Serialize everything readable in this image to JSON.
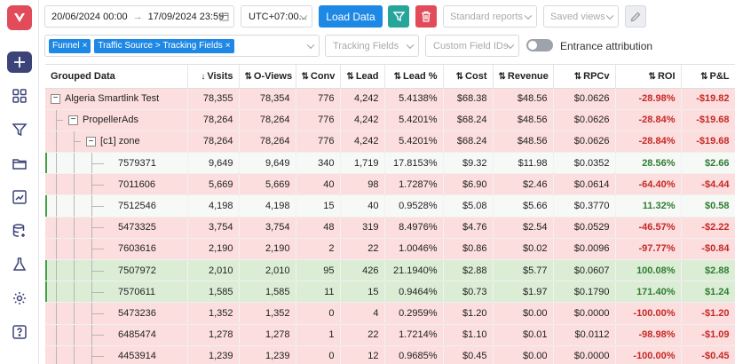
{
  "sidebar": {
    "items": [
      "plus-icon",
      "dashboard-icon",
      "funnel-icon",
      "folder-icon",
      "chart-icon",
      "database-icon",
      "flask-icon",
      "gear-icon",
      "help-icon"
    ]
  },
  "toolbar": {
    "date_from": "20/06/2024 00:00",
    "date_sep": "→",
    "date_to": "17/09/2024 23:59",
    "timezone": "UTC+07:00...",
    "load_label": "Load Data",
    "standard_reports": "Standard reports",
    "saved_views": "Saved views"
  },
  "filters": {
    "tags": [
      "Funnel",
      "Traffic Source > Tracking Fields"
    ],
    "tracking_fields": "Tracking Fields",
    "custom_field_ids": "Custom Field IDs",
    "entrance_attribution": "Entrance attribution"
  },
  "colors": {
    "accent": "#1e88e5",
    "filter_btn": "#26a69a",
    "delete_btn": "#e14b5a",
    "neg_row": "#fbdedd",
    "pos_row": "#dcedd6"
  },
  "table": {
    "columns": [
      "Grouped Data",
      "Visits",
      "O-Views",
      "Conv",
      "Lead",
      "Lead %",
      "Cost",
      "Revenue",
      "RPCv",
      "ROI",
      "P&L"
    ],
    "sort_arrows": [
      "",
      "↓",
      "⇅",
      "⇅",
      "⇅",
      "⇅",
      "⇅",
      "⇅",
      "⇅",
      "⇅",
      "⇅"
    ],
    "rows": [
      {
        "level": 0,
        "toggle": "−",
        "name": "Algeria Smartlink Test",
        "tone": "neg",
        "cells": [
          "78,355",
          "78,354",
          "776",
          "4,242",
          "5.4138%",
          "$68.38",
          "$48.56",
          "$0.0626",
          "-28.98%",
          "-$19.82"
        ]
      },
      {
        "level": 1,
        "toggle": "−",
        "name": "PropellerAds",
        "tone": "neg",
        "cells": [
          "78,264",
          "78,264",
          "776",
          "4,242",
          "5.4201%",
          "$68.24",
          "$48.56",
          "$0.0626",
          "-28.84%",
          "-$19.68"
        ]
      },
      {
        "level": 2,
        "toggle": "−",
        "name": "[c1] zone",
        "tone": "neg",
        "cells": [
          "78,264",
          "78,264",
          "776",
          "4,242",
          "5.4201%",
          "$68.24",
          "$48.56",
          "$0.0626",
          "-28.84%",
          "-$19.68"
        ]
      },
      {
        "level": 3,
        "toggle": "",
        "name": "7579371",
        "tone": "neu",
        "cells": [
          "9,649",
          "9,649",
          "340",
          "1,719",
          "17.8153%",
          "$9.32",
          "$11.98",
          "$0.0352",
          "28.56%",
          "$2.66"
        ]
      },
      {
        "level": 3,
        "toggle": "",
        "name": "7011606",
        "tone": "neg",
        "cells": [
          "5,669",
          "5,669",
          "40",
          "98",
          "1.7287%",
          "$6.90",
          "$2.46",
          "$0.0614",
          "-64.40%",
          "-$4.44"
        ]
      },
      {
        "level": 3,
        "toggle": "",
        "name": "7512546",
        "tone": "neu",
        "cells": [
          "4,198",
          "4,198",
          "15",
          "40",
          "0.9528%",
          "$5.08",
          "$5.66",
          "$0.3770",
          "11.32%",
          "$0.58"
        ]
      },
      {
        "level": 3,
        "toggle": "",
        "name": "5473325",
        "tone": "neg",
        "cells": [
          "3,754",
          "3,754",
          "48",
          "319",
          "8.4976%",
          "$4.76",
          "$2.54",
          "$0.0529",
          "-46.57%",
          "-$2.22"
        ]
      },
      {
        "level": 3,
        "toggle": "",
        "name": "7603616",
        "tone": "neg",
        "cells": [
          "2,190",
          "2,190",
          "2",
          "22",
          "1.0046%",
          "$0.86",
          "$0.02",
          "$0.0096",
          "-97.77%",
          "-$0.84"
        ]
      },
      {
        "level": 3,
        "toggle": "",
        "name": "7507972",
        "tone": "pos",
        "cells": [
          "2,010",
          "2,010",
          "95",
          "426",
          "21.1940%",
          "$2.88",
          "$5.77",
          "$0.0607",
          "100.08%",
          "$2.88"
        ]
      },
      {
        "level": 3,
        "toggle": "",
        "name": "7570611",
        "tone": "pos",
        "cells": [
          "1,585",
          "1,585",
          "11",
          "15",
          "0.9464%",
          "$0.73",
          "$1.97",
          "$0.1790",
          "171.40%",
          "$1.24"
        ]
      },
      {
        "level": 3,
        "toggle": "",
        "name": "5473236",
        "tone": "neg",
        "cells": [
          "1,352",
          "1,352",
          "0",
          "4",
          "0.2959%",
          "$1.20",
          "$0.00",
          "$0.0000",
          "-100.00%",
          "-$1.20"
        ]
      },
      {
        "level": 3,
        "toggle": "",
        "name": "6485474",
        "tone": "neg",
        "cells": [
          "1,278",
          "1,278",
          "1",
          "22",
          "1.7214%",
          "$1.10",
          "$0.01",
          "$0.0112",
          "-98.98%",
          "-$1.09"
        ]
      },
      {
        "level": 3,
        "toggle": "",
        "name": "4453914",
        "tone": "neg",
        "cells": [
          "1,239",
          "1,239",
          "0",
          "12",
          "0.9685%",
          "$0.45",
          "$0.00",
          "$0.0000",
          "-100.00%",
          "-$0.45"
        ]
      }
    ]
  }
}
